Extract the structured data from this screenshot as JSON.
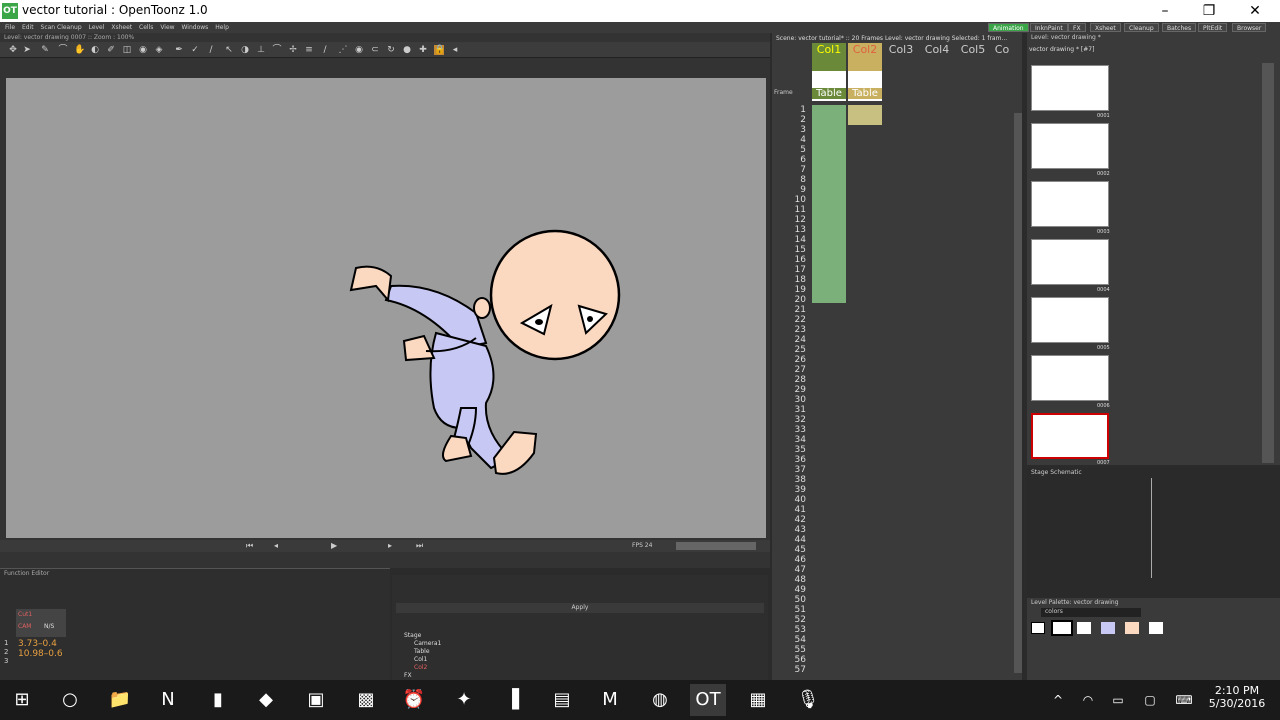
{
  "window": {
    "title": "vector tutorial : OpenToonz 1.0",
    "logo": "OT",
    "min": "–",
    "max": "❐",
    "close": "✕"
  },
  "menu": [
    "File",
    "Edit",
    "Scan Cleanup",
    "Level",
    "Xsheet",
    "Cells",
    "View",
    "Windows",
    "Help"
  ],
  "rooms": [
    "Animation",
    "InknPaint",
    "FX",
    "Xsheet",
    "Cleanup",
    "Batches",
    "PltEdit",
    "Browser"
  ],
  "viewer": {
    "title": "Level: vector drawing 0007 :: Zoom : 100%",
    "fps_label": "FPS 24"
  },
  "xsheet": {
    "title": "Scene: vector tutorial* :: 20 Frames  Level: vector drawing  Selected: 1 fram...",
    "columns": [
      "Col1",
      "Col2",
      "Col3",
      "Col4",
      "Col5",
      "Co"
    ],
    "pegs": [
      "Table",
      "Table"
    ],
    "frame_label": "Frame"
  },
  "level_strip": {
    "title": "Level: vector drawing *",
    "sub": "vector drawing * [#7]",
    "frames": [
      "0001",
      "0002",
      "0003",
      "0004",
      "0005",
      "0006",
      "0007"
    ]
  },
  "stage_schematic": {
    "title": "Stage Schematic"
  },
  "function_editor": {
    "title": "Function Editor",
    "col1": "Cut1",
    "col2": "N/S",
    "col3": "CAM",
    "values": [
      "3.73–0.4",
      "10.98–0.6"
    ],
    "row_nums": [
      "1",
      "2",
      "3"
    ]
  },
  "tree": {
    "apply": "Apply",
    "nodes": [
      "Stage",
      "Camera1",
      "Table",
      "Col1",
      "Col2",
      "FX"
    ]
  },
  "palette": {
    "title": "Level Palette: vector drawing",
    "name": "colors"
  },
  "taskbar": {
    "time": "2:10 PM",
    "date": "5/30/2016"
  }
}
